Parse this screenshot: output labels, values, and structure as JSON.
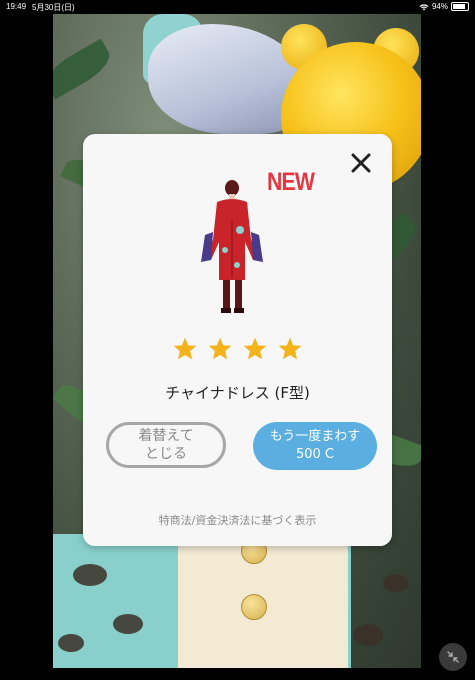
{
  "status_bar": {
    "time": "19:49",
    "date": "5月30日(日)",
    "battery": "94%"
  },
  "modal": {
    "new_badge": "NEW",
    "rarity_stars": 4,
    "item_name": "チャイナドレス (F型)",
    "close_change_button": {
      "line1": "着替えて",
      "line2": "とじる"
    },
    "spin_again_button": {
      "line1": "もう一度まわす",
      "line2": "500 C"
    },
    "legal_link": "特商法/資金決済法に基づく表示"
  },
  "icons": {
    "close": "close-icon",
    "star": "star-icon",
    "shrink": "shrink-icon",
    "wifi": "wifi-icon",
    "battery": "battery-icon"
  },
  "colors": {
    "spin_button": "#5aafe0",
    "new_badge": "#e8353f",
    "star": "#f4b21b",
    "modal_bg": "#f7f7f7"
  }
}
